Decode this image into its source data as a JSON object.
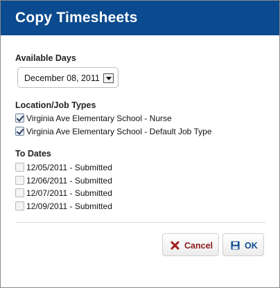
{
  "dialog": {
    "title": "Copy Timesheets"
  },
  "available_days": {
    "label": "Available Days",
    "selected": "December 08, 2011"
  },
  "location_job_types": {
    "label": "Location/Job Types",
    "items": [
      {
        "label": "Virginia Ave Elementary School - Nurse",
        "checked": true
      },
      {
        "label": "Virginia Ave Elementary School - Default Job Type",
        "checked": true
      }
    ]
  },
  "to_dates": {
    "label": "To Dates",
    "items": [
      {
        "label": "12/05/2011 - Submitted",
        "checked": false,
        "disabled": true
      },
      {
        "label": "12/06/2011 - Submitted",
        "checked": false,
        "disabled": true
      },
      {
        "label": "12/07/2011 - Submitted",
        "checked": false,
        "disabled": true
      },
      {
        "label": "12/09/2011 - Submitted",
        "checked": false,
        "disabled": true
      }
    ]
  },
  "buttons": {
    "cancel_label": "Cancel",
    "ok_label": "OK",
    "cancel_icon": "close-x-icon",
    "ok_icon": "floppy-disk-save-icon"
  },
  "colors": {
    "title_bar": "#0b4a8e",
    "cancel_text": "#8b1a1a",
    "ok_text": "#0b4a8e"
  }
}
